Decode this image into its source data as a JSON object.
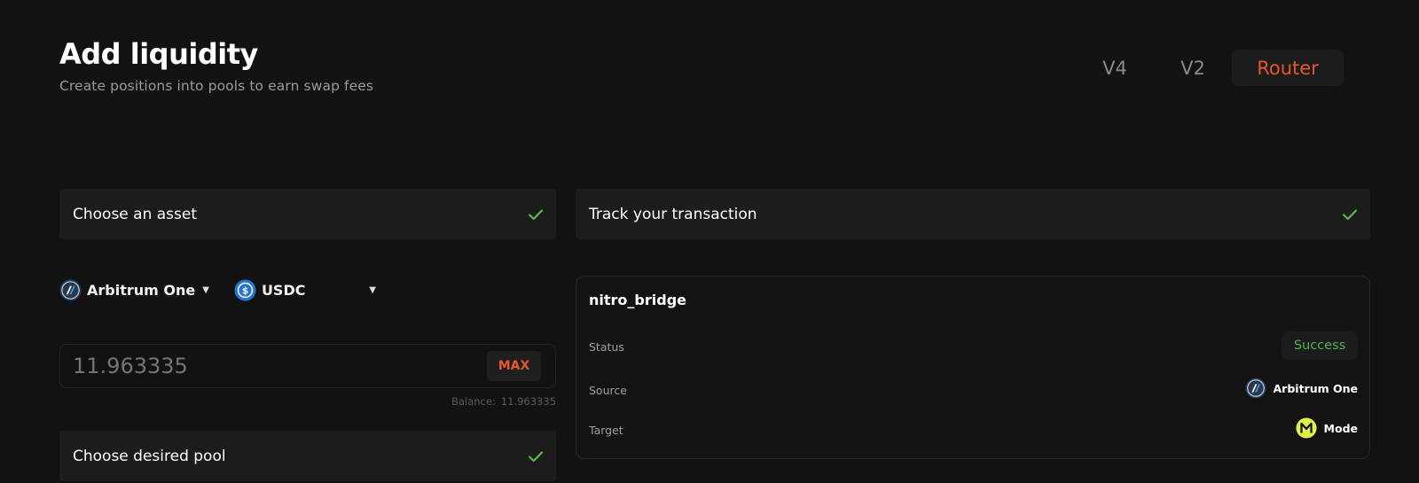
{
  "header": {
    "title": "Add liquidity",
    "subtitle": "Create positions into pools to earn swap fees"
  },
  "version_tabs": [
    {
      "label": "V4",
      "active": false
    },
    {
      "label": "V2",
      "active": false
    },
    {
      "label": "Router",
      "active": true
    }
  ],
  "steps": {
    "choose_asset": {
      "label": "Choose an asset",
      "completed": true
    },
    "track_transaction": {
      "label": "Track your transaction",
      "completed": true
    },
    "choose_pool": {
      "label": "Choose desired pool",
      "completed": true
    }
  },
  "asset_form": {
    "network": {
      "label": "Arbitrum One",
      "icon": "arbitrum-icon"
    },
    "token": {
      "label": "USDC",
      "icon": "usdc-icon"
    },
    "amount_placeholder": "11.963335",
    "max_label": "MAX",
    "balance_label": "Balance:",
    "balance_value": "11.963335"
  },
  "transaction": {
    "name": "nitro_bridge",
    "status_label": "Status",
    "status_value": "Success",
    "source_label": "Source",
    "source_value": "Arbitrum One",
    "target_label": "Target",
    "target_value": "Mode"
  },
  "colors": {
    "background": "#121212",
    "panel": "#1c1c1c",
    "accent": "#e8542e",
    "success": "#54b14a",
    "check": "#5cb84d",
    "mode_yellow": "#dff048"
  }
}
